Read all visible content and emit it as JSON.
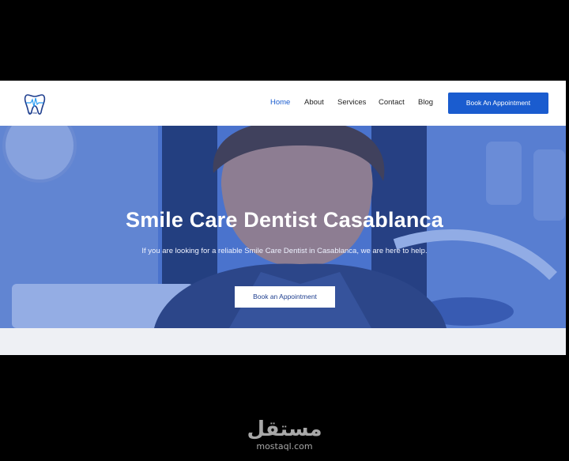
{
  "nav": {
    "items": [
      {
        "label": "Home",
        "active": true
      },
      {
        "label": "About",
        "active": false
      },
      {
        "label": "Services",
        "active": false
      },
      {
        "label": "Contact",
        "active": false
      },
      {
        "label": "Blog",
        "active": false
      }
    ],
    "cta_label": "Book An Appointment"
  },
  "logo": {
    "text": "dental"
  },
  "hero": {
    "title": "Smile Care Dentist Casablanca",
    "subtitle": "If you are looking for a reliable Smile Care Dentist in Casablanca, we are here to help.",
    "button_label": "Book an Appointment"
  },
  "watermark": {
    "arabic": "مستقل",
    "latin": "mostaql.com"
  },
  "colors": {
    "accent": "#1a5ccf",
    "hero_tint": "#4f74c6",
    "header_bg": "#ffffff"
  }
}
